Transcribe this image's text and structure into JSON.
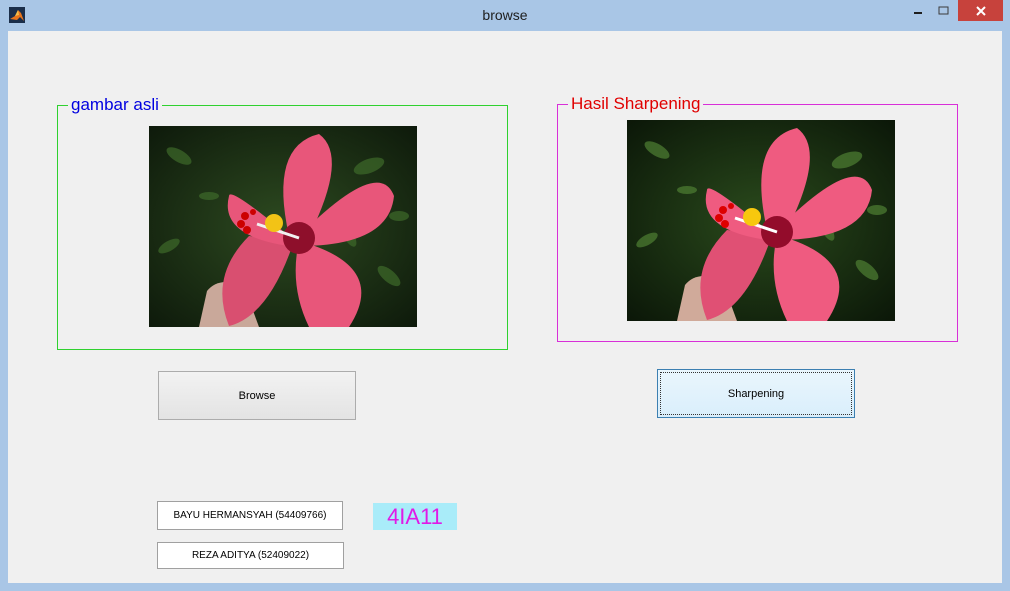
{
  "window": {
    "title": "browse"
  },
  "colors": {
    "left_frame": "#2fd12f",
    "left_title": "#0000e0",
    "right_frame": "#d82fd8",
    "right_title": "#e00000",
    "class_label": "#e01ae6",
    "class_label_bg": "#a9ecf9"
  },
  "panels": {
    "original": {
      "title": "gambar asli"
    },
    "result": {
      "title": "Hasil Sharpening"
    }
  },
  "buttons": {
    "browse": "Browse",
    "sharpen": "Sharpening"
  },
  "authors": [
    "BAYU HERMANSYAH (54409766)",
    "REZA ADITYA (52409022)"
  ],
  "class_label": "4IA11",
  "icons": [
    "matlab-icon",
    "minimize-icon",
    "maximize-icon",
    "close-icon",
    "hibiscus-flower-image"
  ]
}
